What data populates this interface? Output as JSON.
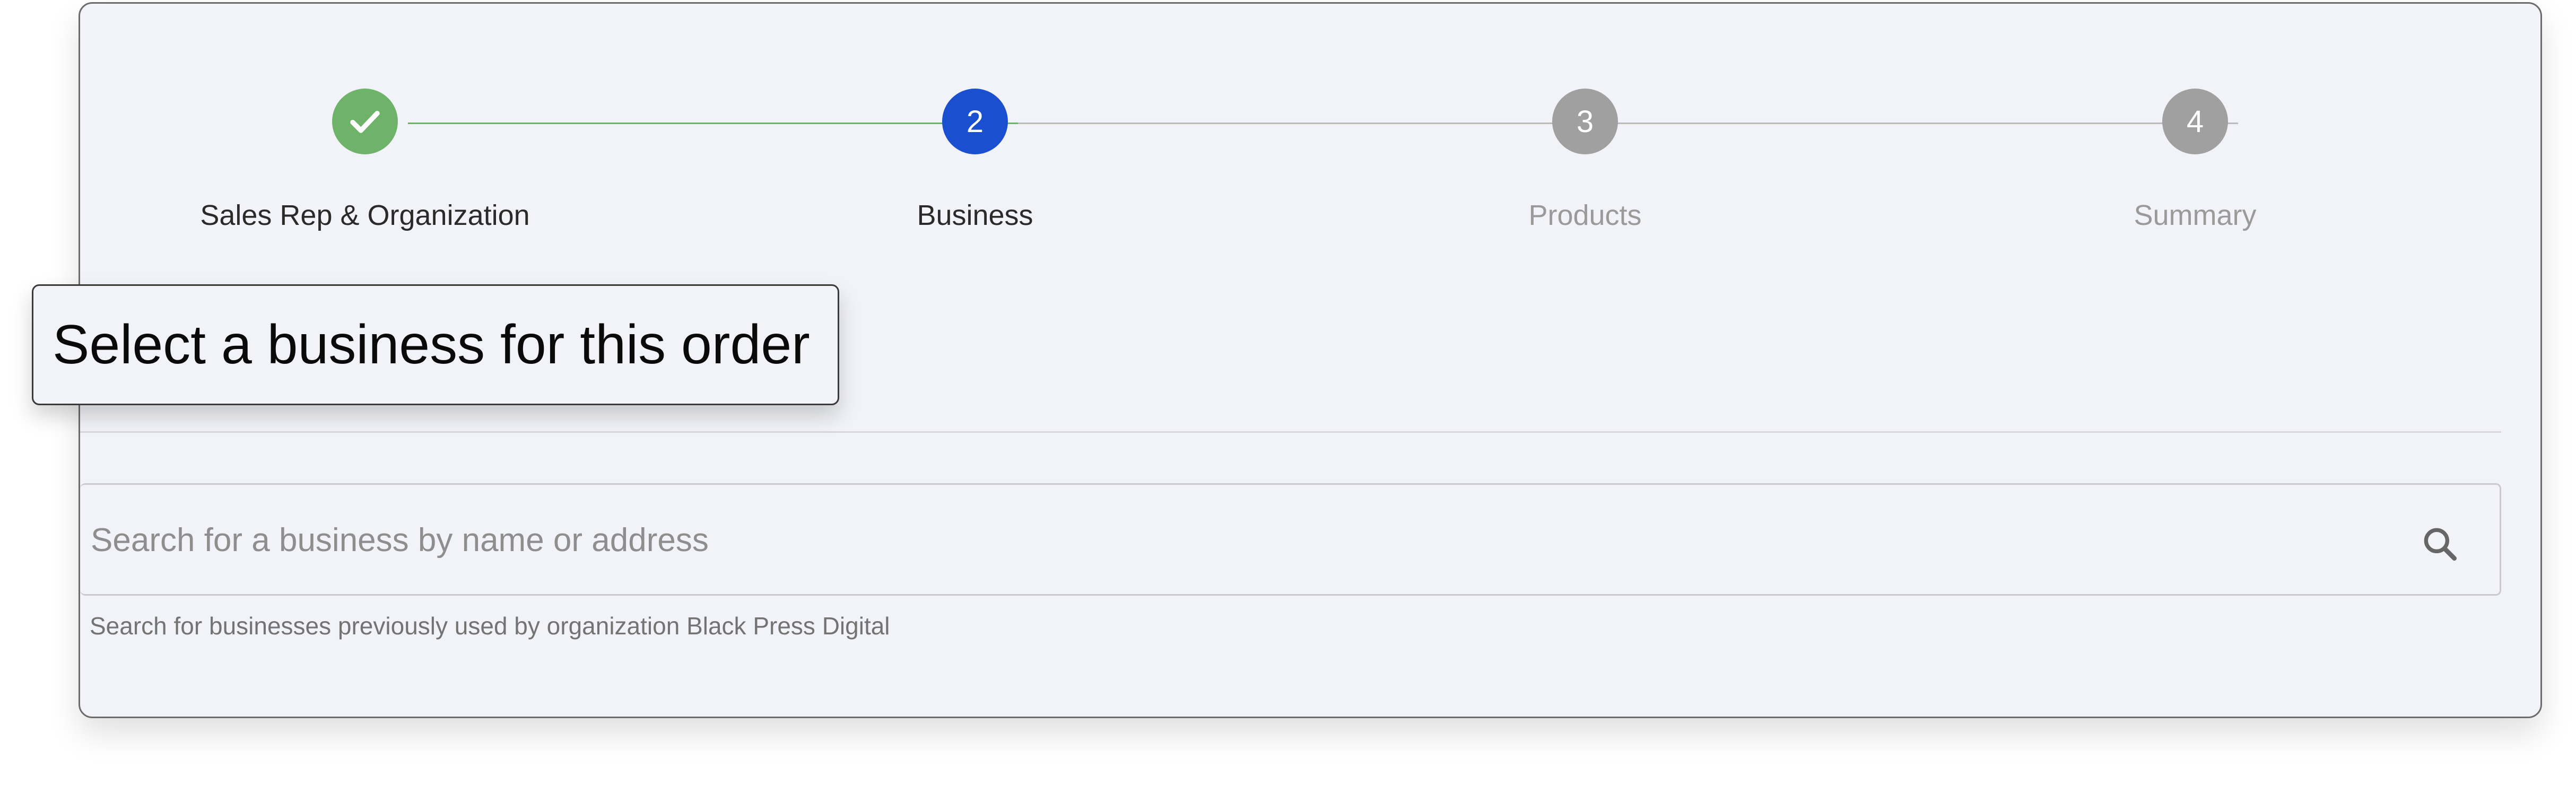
{
  "stepper": {
    "steps": [
      {
        "number": "",
        "label": "Sales Rep & Organization",
        "state": "completed",
        "icon": "check-icon"
      },
      {
        "number": "2",
        "label": "Business",
        "state": "active"
      },
      {
        "number": "3",
        "label": "Products",
        "state": "upcoming"
      },
      {
        "number": "4",
        "label": "Summary",
        "state": "upcoming"
      }
    ],
    "colors": {
      "completed": "#6fb36a",
      "active": "#1a4fd0",
      "upcoming": "#a0a0a0"
    }
  },
  "tooltip": {
    "text": "Select a business for this order"
  },
  "search": {
    "placeholder": "Search for a business by name or address",
    "value": "",
    "icon": "search-icon",
    "helper_text": "Search for businesses previously used by organization Black Press Digital"
  }
}
